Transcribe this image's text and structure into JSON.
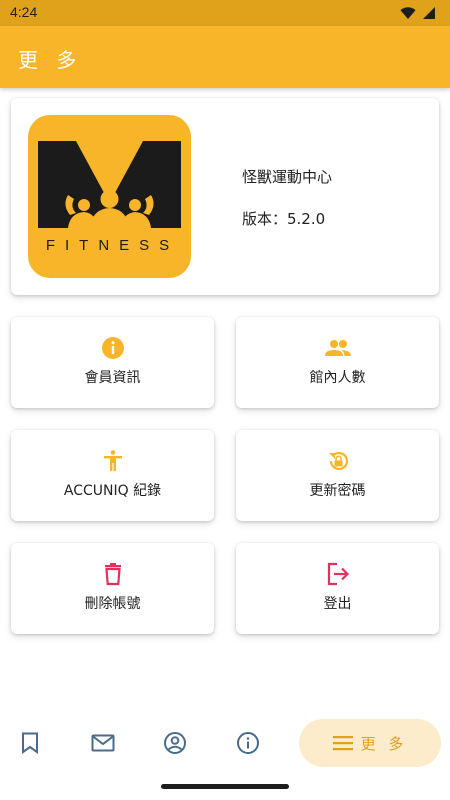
{
  "status_bar": {
    "time": "4:24"
  },
  "app_bar": {
    "title": "更 多"
  },
  "profile": {
    "logo_wordmark": "FITNESS",
    "gym_name": "怪獸運動中心",
    "version": "版本：5.2.0"
  },
  "tiles": [
    {
      "label": "會員資訊",
      "icon": "info-icon",
      "color": "#f8b52a"
    },
    {
      "label": "館內人數",
      "icon": "people-icon",
      "color": "#f8b52a"
    },
    {
      "label": "ACCUNIQ 紀錄",
      "icon": "accessibility-icon",
      "color": "#f8b52a"
    },
    {
      "label": "更新密碼",
      "icon": "lock-reset-icon",
      "color": "#f8b52a"
    },
    {
      "label": "刪除帳號",
      "icon": "trash-icon",
      "color": "#e0325a"
    },
    {
      "label": "登出",
      "icon": "logout-icon",
      "color": "#e0325a"
    }
  ],
  "bottom_nav": {
    "items": [
      {
        "icon": "bookmark-icon"
      },
      {
        "icon": "mail-icon"
      },
      {
        "icon": "account-circle-icon"
      },
      {
        "icon": "info-outline-icon"
      }
    ],
    "active_label": "更 多",
    "active_icon": "menu-icon"
  },
  "colors": {
    "primary": "#f8b52a",
    "status_bar": "#dfa21a",
    "danger": "#e0325a",
    "nav_icon": "#4a6c8c"
  }
}
